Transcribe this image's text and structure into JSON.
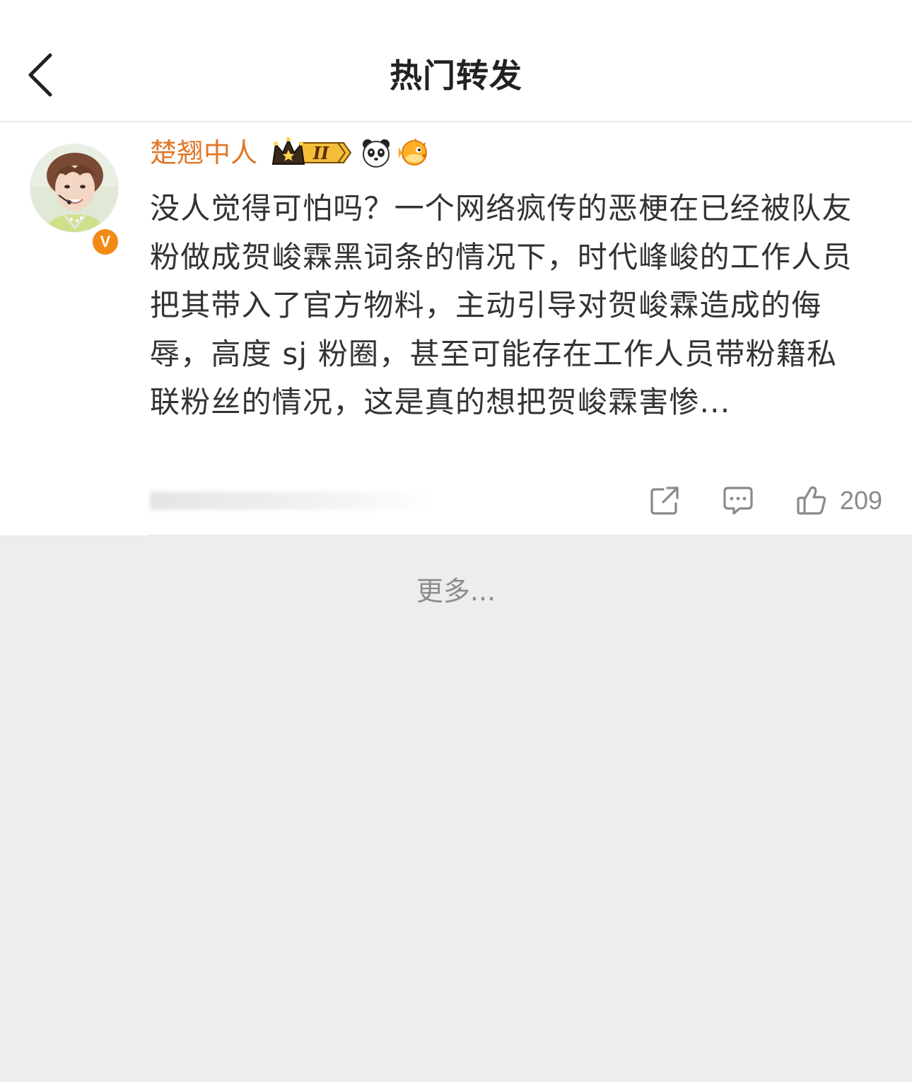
{
  "nav": {
    "title": "热门转发",
    "back_icon": "chevron-left-icon"
  },
  "post": {
    "username": "楚翘中人",
    "member_level": "II",
    "verified_mark": "V",
    "badges": [
      "crown-level-icon",
      "panda-icon",
      "pufferfish-icon"
    ],
    "text": "没人觉得可怕吗？一个网络疯传的恶梗在已经被队友粉做成贺峻霖黑词条的情况下，时代峰峻的工作人员把其带入了官方物料，主动引导对贺峻霖造成的侮辱，高度 sj 粉圈，甚至可能存在工作人员带粉籍私联粉丝的情况，这是真的想把贺峻霖害惨...",
    "like_count": "209"
  },
  "footer": {
    "more_label": "更多..."
  },
  "colors": {
    "username": "#e0782a",
    "verified": "#f28a16",
    "text": "#333333",
    "muted": "#8a8a8a",
    "page_bg": "#ededed"
  }
}
